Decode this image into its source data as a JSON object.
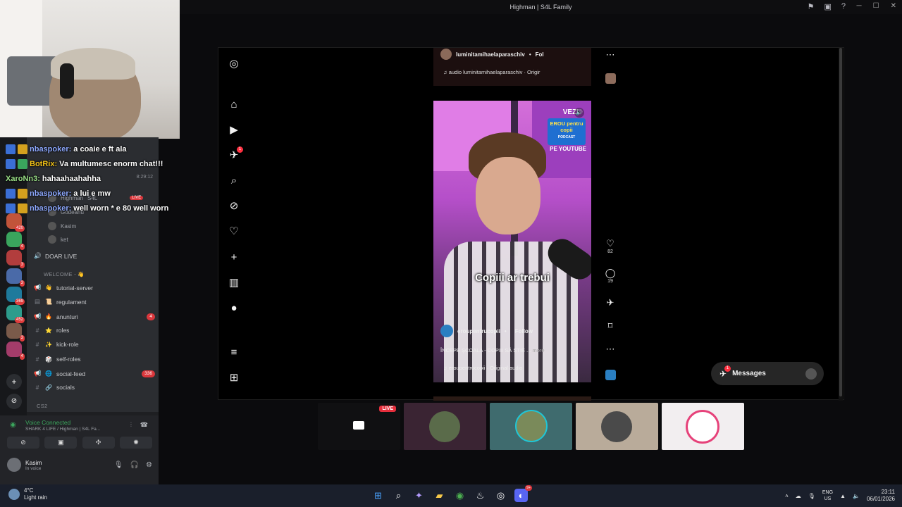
{
  "window": {
    "title": "Highman | S4L Family"
  },
  "chat": [
    {
      "user": "nbaspoker:",
      "message": "a coaie e ft ala",
      "color": "#8ea9ff"
    },
    {
      "user": "BotRix:",
      "message": "Va multumesc enorm chat!!!",
      "color": "#f5c518"
    },
    {
      "user": "XaroNn3:",
      "message": "hahaahaahahha",
      "color": "#9adf87"
    },
    {
      "user": "nbaspoker:",
      "message": "a lui e mw",
      "color": "#8ea9ff"
    },
    {
      "user": "nbaspoker:",
      "message": "well worn * e 80 well worn",
      "color": "#8ea9ff"
    }
  ],
  "discord": {
    "timestamp": "8:29:12",
    "voice_users": [
      {
        "name": "Highman",
        "tag": "S4L",
        "live": "LIVE"
      },
      {
        "name": "Godeanu"
      },
      {
        "name": "Kasim"
      },
      {
        "name": "ket"
      }
    ],
    "doar_live": "DOAR LIVE",
    "category_welcome": "WELCOME - 👋",
    "channels": [
      {
        "name": "tutorial-server",
        "emoji": "👋"
      },
      {
        "name": "regulament",
        "emoji": "📜"
      },
      {
        "name": "anunturi",
        "emoji": "🔥",
        "badge": "4"
      },
      {
        "name": "roles",
        "emoji": "⭐"
      },
      {
        "name": "kick-role",
        "emoji": "✨"
      },
      {
        "name": "self-roles",
        "emoji": "🎲"
      },
      {
        "name": "social-feed",
        "emoji": "🌐",
        "badge": "336"
      },
      {
        "name": "socials",
        "emoji": "🔗"
      }
    ],
    "category_cs2": "CS2",
    "server_badges": [
      "420",
      "4",
      "3",
      "3",
      "369",
      "452",
      "3",
      "4"
    ],
    "voice_connected": "Voice Connected",
    "voice_channel": "SHARK 4 LIFE / Highman | S4L Fa...",
    "user": {
      "name": "Kasim",
      "status": "In voice"
    }
  },
  "instagram": {
    "top_reel": {
      "account": "luminitamihaelaparaschiv",
      "follow": "Fol",
      "audio": "audio  luminitamihaelaparaschiv · Origir"
    },
    "reel": {
      "vezi": "VEZI",
      "promo": "EROU pentru copii",
      "promo_sub": "PODCAST",
      "pe_youtube": "PE YOUTUBE",
      "caption": "Copiii ar trebui",
      "account": "eroupentrucopii",
      "follow": "Follow",
      "description": "ÎNCEPE ȘCOALA - COPIII SĂ ȘTIE ...",
      "more": "more",
      "audio": "eroupentrucopii · Original audio"
    },
    "actions": {
      "likes": "82",
      "comments": "19"
    },
    "notification_badge": "1",
    "messages_label": "Messages",
    "messages_badge": "1"
  },
  "thumbnails": [
    {
      "name": "live-screen",
      "live": "LIVE",
      "bg": "#101012"
    },
    {
      "name": "avatar-1",
      "bg": "#3a2433"
    },
    {
      "name": "avatar-2",
      "bg": "#3f6b6e"
    },
    {
      "name": "avatar-3",
      "bg": "#b9ab9a"
    },
    {
      "name": "avatar-4",
      "bg": "#f2eef0"
    }
  ],
  "taskbar": {
    "temperature": "4°C",
    "weather": "Light rain",
    "lang1": "ENG",
    "lang2": "US",
    "time": "23:11",
    "date": "06/01/2026",
    "notif_badge": "9+"
  }
}
